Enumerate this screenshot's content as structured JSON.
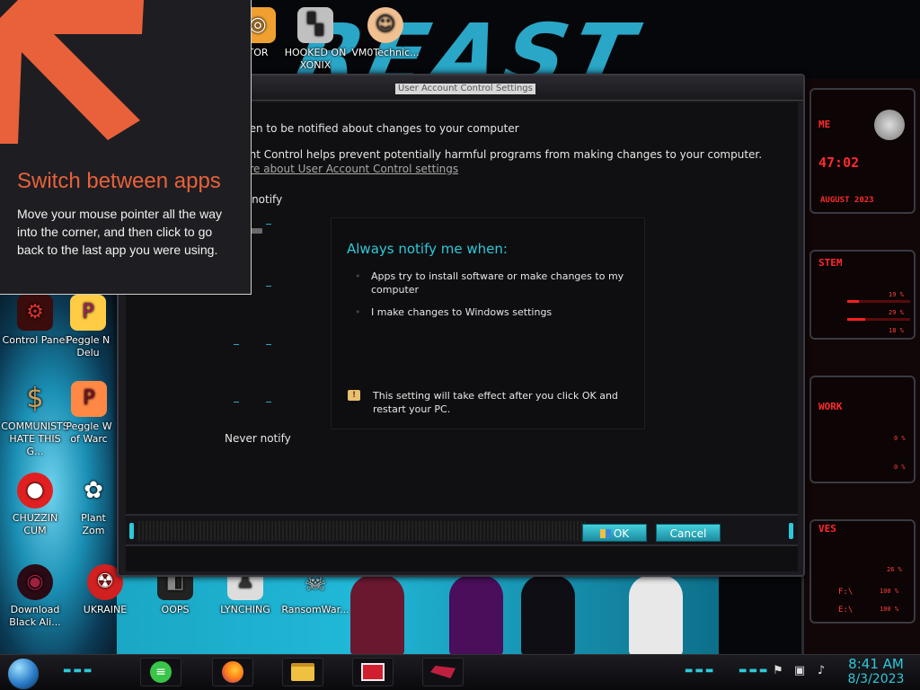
{
  "tip": {
    "title": "Switch between apps",
    "body": "Move your mouse pointer all the way into the corner, and then click to go back to the last app you were using."
  },
  "uac": {
    "title": "User Account Control Settings",
    "heading": "hen to be notified about changes to your computer",
    "description": "unt Control helps prevent potentially harmful programs from making changes to your computer.",
    "link": "ore about User Account Control settings",
    "slider_top_label": "s notify",
    "slider_bottom_label": "Never notify",
    "slider_level": 4,
    "notify_title": "Always notify me when:",
    "notify_items": [
      "Apps try to install software or make changes to my computer",
      "I make changes to Windows settings"
    ],
    "info_text": "This setting will take effect after you click OK and restart your PC.",
    "ok_label": "OK",
    "cancel_label": "Cancel"
  },
  "desktop_icons": [
    {
      "label": "TOR",
      "icon": "app-icon",
      "color": "#f0a030"
    },
    {
      "label": "HOOKED ON XONIX",
      "icon": "game-icon",
      "color": "#c0c0c0"
    },
    {
      "label": "VM0Technic...",
      "icon": "doctor-icon",
      "color": "#f0c090"
    },
    {
      "label": "Control Panel",
      "icon": "control-panel-icon",
      "color": "#b02020"
    },
    {
      "label": "Peggle N Delu",
      "icon": "peggle-icon",
      "color": "#ffcc44"
    },
    {
      "label": "COMMUNISTS HATE THIS G...",
      "icon": "money-bag-icon",
      "color": "#c8a060"
    },
    {
      "label": "Peggle W of Warc",
      "icon": "peggle-icon",
      "color": "#ff8844"
    },
    {
      "label": "CHUZZIN CUM",
      "icon": "chuzzle-icon",
      "color": "#e02020"
    },
    {
      "label": "Plant Zom",
      "icon": "flower-icon",
      "color": "#ffffff"
    },
    {
      "label": "Download Black Ali...",
      "icon": "alien-icon",
      "color": "#a02040"
    },
    {
      "label": "UKRAINE",
      "icon": "radiation-icon",
      "color": "#d02020"
    },
    {
      "label": "OOPS",
      "icon": "app-icon",
      "color": "#888888"
    },
    {
      "label": "LYNCHING",
      "icon": "app-icon",
      "color": "#dddddd"
    },
    {
      "label": "RansomWar...",
      "icon": "skull-icon",
      "color": "#cccccc"
    }
  ],
  "gadget": {
    "time": "47:02",
    "date": "AUGUST 2023",
    "system_label": "STEM",
    "cpu": [
      "19 %",
      "29 %",
      "18 %"
    ],
    "network_label": "WORK",
    "net": [
      "0 %",
      "0 %"
    ],
    "drives_label": "VES",
    "drive_vals": [
      "26 %"
    ],
    "drive_rows": [
      {
        "name": "F:\\",
        "value": "100 %"
      },
      {
        "name": "E:\\",
        "value": "100 %"
      }
    ]
  },
  "taskbar": {
    "apps": [
      {
        "name": "chat-app",
        "icon": "chat-icon",
        "color": "#3ac44a"
      },
      {
        "name": "firefox",
        "icon": "firefox-icon",
        "color": "#ff7a1a"
      },
      {
        "name": "file-explorer",
        "icon": "folder-icon",
        "color": "#f0c040"
      },
      {
        "name": "news-app",
        "icon": "news-icon",
        "color": "#d02030"
      },
      {
        "name": "alien-app",
        "icon": "alien-ship-icon",
        "color": "#c02040"
      }
    ],
    "time": "8:41 AM",
    "date": "8/3/2023"
  },
  "colors": {
    "accent_cyan": "#2ec8d8",
    "tip_orange": "#e8613a",
    "gadget_red": "#ff2a2a"
  }
}
